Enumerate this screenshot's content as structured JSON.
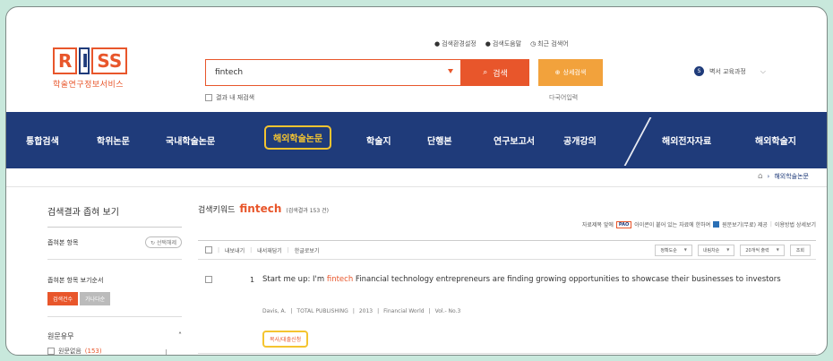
{
  "colors": {
    "brand_orange": "#e8562b",
    "nav_blue": "#1f3b7a",
    "highlight": "#f4c430",
    "background": "#c8e8dc"
  },
  "logo": {
    "letters": [
      "R",
      "I",
      "SS"
    ],
    "subtitle": "학술연구정보서비스"
  },
  "top_links": [
    "검색환경설정",
    "검색도움말",
    "최근 검색어"
  ],
  "search": {
    "value": "fintech",
    "button_label": "검색",
    "detail_label": "상세검색",
    "within_label": "결과 내 재검색",
    "multilang_label": "다국어입력"
  },
  "user": {
    "badge": "S",
    "label": "벽서 교육과정"
  },
  "nav": {
    "items": [
      "통합검색",
      "학위논문",
      "국내학술논문",
      "해외학술논문",
      "학술지",
      "단행본",
      "연구보고서",
      "공개강의",
      "해외전자자료",
      "해외학술지"
    ],
    "active_index": 3
  },
  "breadcrumb": {
    "current": "해외학술논문"
  },
  "sidebar": {
    "title": "검색결과 좁혀 보기",
    "filter_label": "좁혀본 항목",
    "reset_label": "선택해제",
    "sort_label": "좁혀본 항목 보기순서",
    "sort_options": [
      "검색건수",
      "가나다순"
    ],
    "section_title": "원문유무",
    "item_label": "원문없음",
    "item_count": "(153)"
  },
  "results": {
    "keyword_prefix": "검색키워드",
    "keyword": "fintech",
    "count_text": "(검색결과 153 건)",
    "notice_text": "자료제목 앞에",
    "notice_tag": "PAO",
    "notice_text2": "아이콘이 붙어 있는 자료에 한하여",
    "notice_text3": "원문보기(무료) 제공",
    "notice_link": "이용방법 상세보기",
    "toolbar": [
      "내보내기",
      "내서재담기",
      "한글로보기"
    ],
    "sort_selects": [
      "정확도순",
      "내림차순",
      "20개씩 출력"
    ],
    "view_button": "조회"
  },
  "result_item": {
    "number": "1",
    "title_before": "Start me up: I'm ",
    "title_highlight": "fintech",
    "title_after": " Financial technology entrepreneurs are finding growing opportunities to showcase their businesses to investors",
    "author": "Davis, A.",
    "publisher": "TOTAL PUBLISHING",
    "year": "2013",
    "journal": "Financial World",
    "volume": "Vol.- No.3",
    "request_label": "복사/대출신청"
  }
}
